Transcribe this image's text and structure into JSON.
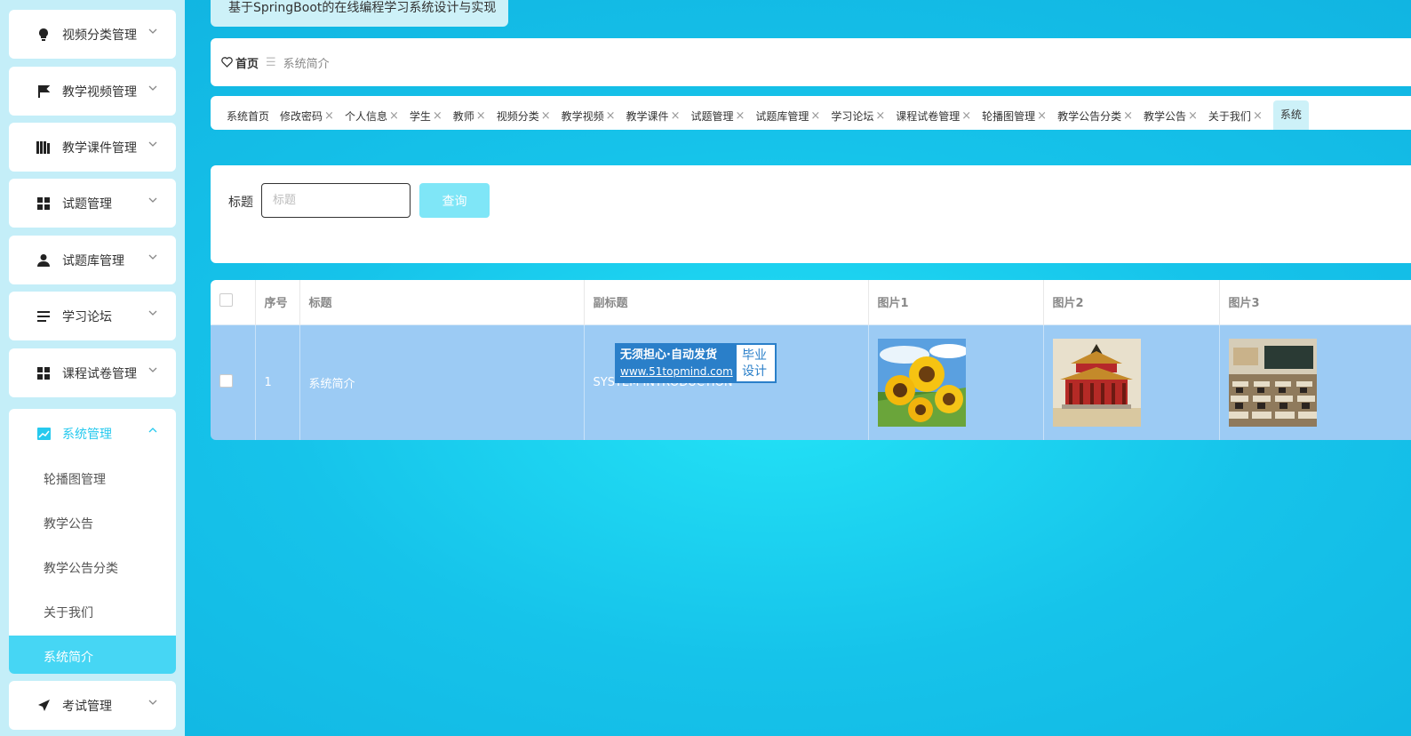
{
  "sidebar": {
    "items": [
      {
        "label": "视频分类管理",
        "icon": "lightbulb-icon"
      },
      {
        "label": "教学视频管理",
        "icon": "flag-icon"
      },
      {
        "label": "教学课件管理",
        "icon": "library-icon"
      },
      {
        "label": "试题管理",
        "icon": "grid-icon"
      },
      {
        "label": "试题库管理",
        "icon": "user-icon"
      },
      {
        "label": "学习论坛",
        "icon": "list-icon"
      },
      {
        "label": "课程试卷管理",
        "icon": "grid-icon"
      }
    ],
    "open_menu": {
      "label": "系统管理",
      "icon": "chart-icon",
      "children": [
        "轮播图管理",
        "教学公告",
        "教学公告分类",
        "关于我们",
        "系统简介"
      ],
      "active_child": "系统简介"
    },
    "bottom_item": {
      "label": "考试管理",
      "icon": "paper-plane-icon"
    }
  },
  "header": {
    "title": "基于SpringBoot的在线编程学习系统设计与实现"
  },
  "breadcrumb": {
    "home": "首页",
    "current": "系统简介"
  },
  "tabs": [
    {
      "label": "系统首页",
      "closable": false
    },
    {
      "label": "修改密码",
      "closable": true
    },
    {
      "label": "个人信息",
      "closable": true
    },
    {
      "label": "学生",
      "closable": true
    },
    {
      "label": "教师",
      "closable": true
    },
    {
      "label": "视频分类",
      "closable": true
    },
    {
      "label": "教学视频",
      "closable": true
    },
    {
      "label": "教学课件",
      "closable": true
    },
    {
      "label": "试题管理",
      "closable": true
    },
    {
      "label": "试题库管理",
      "closable": true
    },
    {
      "label": "学习论坛",
      "closable": true
    },
    {
      "label": "课程试卷管理",
      "closable": true
    },
    {
      "label": "轮播图管理",
      "closable": true
    },
    {
      "label": "教学公告分类",
      "closable": true
    },
    {
      "label": "教学公告",
      "closable": true
    },
    {
      "label": "关于我们",
      "closable": true
    },
    {
      "label": "系统",
      "closable": false,
      "active": true
    }
  ],
  "tab_close_glyph": "×",
  "search": {
    "label": "标题",
    "placeholder": "标题",
    "value": "",
    "button": "查询"
  },
  "table": {
    "columns": [
      "序号",
      "标题",
      "副标题",
      "图片1",
      "图片2",
      "图片3"
    ],
    "rows": [
      {
        "index": "1",
        "title": "系统简介",
        "subtitle": "SYSTEM INTRODUCTION",
        "images": [
          "sunflower-image",
          "palace-image",
          "classroom-image"
        ]
      }
    ]
  },
  "watermark": {
    "line1": "无须担心·自动发货",
    "line2": "www.51topmind.com",
    "right1": "毕业",
    "right2": "设计"
  },
  "colors": {
    "accent": "#26c9ee",
    "active_bg": "#46d6f4",
    "row_bg": "#9ccbf4",
    "button": "#7fe6f7"
  }
}
